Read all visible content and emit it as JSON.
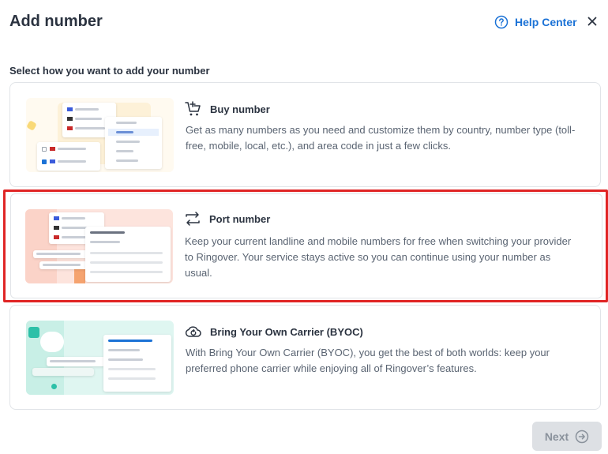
{
  "header": {
    "title": "Add number",
    "help_label": "Help Center"
  },
  "subtitle": "Select how you want to add your number",
  "options": [
    {
      "title": "Buy number",
      "description": "Get as many numbers as you need and customize them by country, number type (toll-free, mobile, local, etc.), and area code in just a few clicks.",
      "icon": "cart-plus-icon"
    },
    {
      "title": "Port number",
      "description": "Keep your current landline and mobile numbers for free when switching your provider to Ringover. Your service stays active so you can continue using your number as usual.",
      "icon": "transfer-arrows-icon"
    },
    {
      "title": "Bring Your Own Carrier (BYOC)",
      "description": "With Bring Your Own Carrier (BYOC), you get the best of both worlds: keep your preferred phone carrier while enjoying all of Ringover’s features.",
      "icon": "cloud-sync-icon"
    }
  ],
  "footer": {
    "next_label": "Next"
  },
  "colors": {
    "accent": "#1b72d6",
    "highlight_border": "#e02424",
    "disabled_button": "#dde0e4"
  }
}
